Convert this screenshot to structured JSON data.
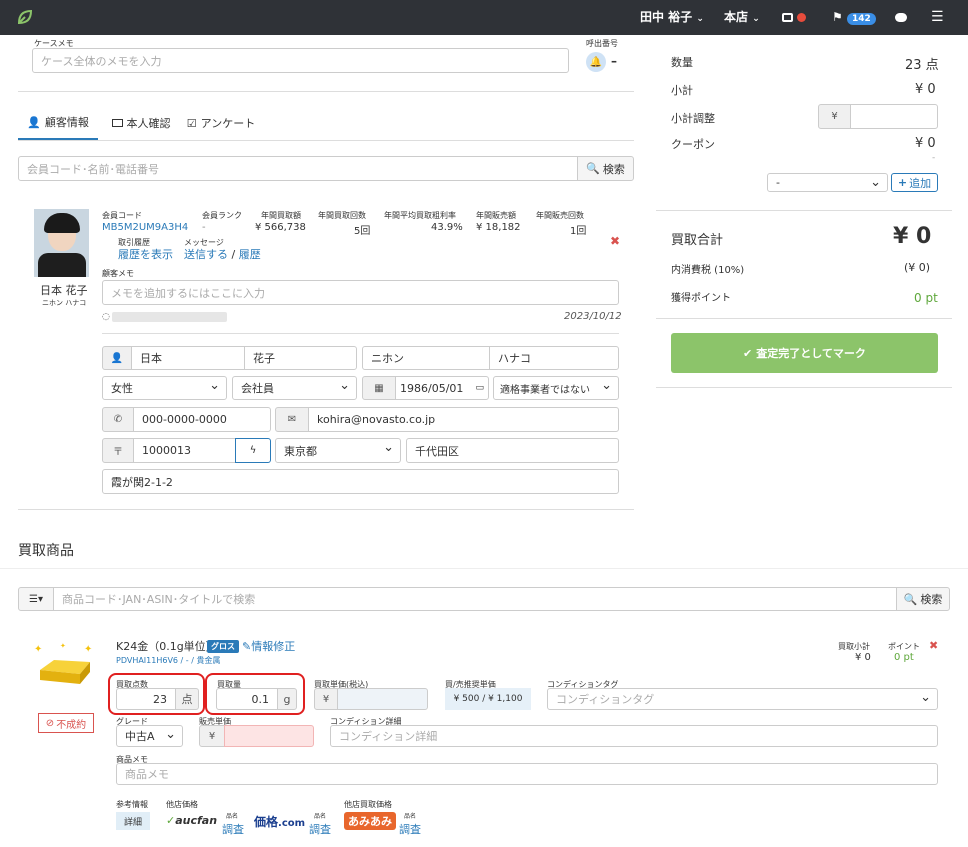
{
  "nav": {
    "user": "田中 裕子",
    "store": "本店",
    "notifications": "142"
  },
  "case_memo": {
    "label": "ケースメモ",
    "placeholder": "ケース全体のメモを入力",
    "call_label": "呼出番号",
    "call_value": "–"
  },
  "tabs": [
    "顧客情報",
    "本人確認",
    "アンケート"
  ],
  "member_search": {
    "placeholder": "会員コード･名前･電話番号",
    "button": "検索"
  },
  "customer": {
    "name": "日本 花子",
    "kana": "ニホン ハナコ",
    "stats": [
      {
        "label": "会員コード",
        "value": "MB5M2UM9A3H4"
      },
      {
        "label": "会員ランク",
        "value": "-"
      },
      {
        "label": "年間買取額",
        "value": "¥ 566,738"
      },
      {
        "label": "年間買取回数",
        "value": "5回"
      },
      {
        "label": "年間平均買取粗利率",
        "value": "43.9%"
      },
      {
        "label": "年間販売額",
        "value": "¥ 18,182"
      },
      {
        "label": "年間販売回数",
        "value": "1回"
      }
    ],
    "history_label": "取引履歴",
    "history_link": "履歴を表示",
    "message_label": "メッセージ",
    "message_send": "送信する",
    "message_sep": "/",
    "message_history": "履歴",
    "memo_label": "顧客メモ",
    "memo_placeholder": "メモを追加するにはここに入力",
    "memo_date": "2023/10/12",
    "last_name": "日本",
    "first_name": "花子",
    "last_kana": "ニホン",
    "first_kana": "ハナコ",
    "gender": "女性",
    "occupation": "会社員",
    "birthday": "1986/05/01",
    "invoice": "適格事業者ではない",
    "phone": "000-0000-0000",
    "email": "kohira@novasto.co.jp",
    "zip_mark": "〒",
    "zip": "1000013",
    "prefecture": "東京都",
    "city": "千代田区",
    "address": "霞が関2-1-2"
  },
  "items_section": {
    "title": "買取商品",
    "search_placeholder": "商品コード･JAN･ASIN･タイトルで検索",
    "search_button": "検索"
  },
  "item": {
    "name": "K24金（0.1g単位）",
    "badge": "グロス",
    "edit_link": "情報修正",
    "code": "PDVHAI11H6V6 / - / 貴金属",
    "status": "不成約",
    "subtotal_label": "買取小計",
    "subtotal": "¥ 0",
    "points_label": "ポイント",
    "points": "0 pt",
    "qty_label": "買取点数",
    "qty": "23",
    "qty_unit": "点",
    "amount_label": "買取量",
    "amount": "0.1",
    "amount_unit": "g",
    "price_label": "買取単価(税込)",
    "yen": "¥",
    "ref_label": "買/売推奨単価",
    "ref_value": "¥ 500 / ¥ 1,100",
    "cond_tag_label": "コンディションタグ",
    "cond_tag_placeholder": "コンディションタグ",
    "grade_label": "グレード",
    "grade": "中古A",
    "sale_price_label": "販売単価",
    "cond_detail_label": "コンディション詳細",
    "cond_detail_placeholder": "コンディション詳細",
    "memo_label": "商品メモ",
    "memo_placeholder": "商品メモ",
    "ref_info_label": "参考情報",
    "detail_button": "詳細",
    "other_price_label": "他店価格",
    "other_buy_label": "他店買取価格",
    "small_label": "品名",
    "survey_link": "調査",
    "aucfan": "aucfan",
    "kakaku_main": "価格",
    "kakaku_sub": ".com",
    "amiami": "あみあみ"
  },
  "summary": {
    "qty_label": "数量",
    "qty_value": "23 点",
    "subtotal_label": "小計",
    "subtotal_value": "¥ 0",
    "adjust_label": "小計調整",
    "yen": "¥",
    "coupon_label": "クーポン",
    "coupon_value": "¥ 0",
    "coupon_dash": "-",
    "coupon_select": "-",
    "add_button": "追加",
    "total_label": "買取合計",
    "total_value": "¥ 0",
    "tax_label": "内消費税 (10%)",
    "tax_value": "(¥ 0)",
    "points_label": "獲得ポイント",
    "points_value": "0 pt",
    "complete_button": "査定完了としてマーク"
  },
  "colors": {
    "nav": "#2f3237",
    "accent": "#2a7ab8",
    "green_button": "#8cc46a",
    "delete": "#d9534f"
  }
}
